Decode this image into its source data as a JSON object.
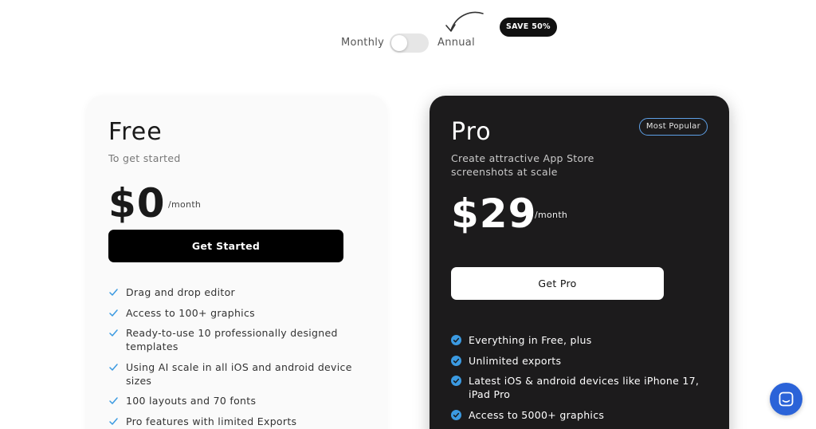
{
  "billing": {
    "monthly_label": "Monthly",
    "annual_label": "Annual",
    "toggle_on": false,
    "save_badge": "SAVE 50%"
  },
  "plans": [
    {
      "name": "Free",
      "description": "To get started",
      "price": "$0",
      "period": "/month",
      "cta": "Get Started",
      "features": [
        "Drag and drop editor",
        "Access to 100+ graphics",
        "Ready-to-use 10 professionally designed templates",
        "Using AI scale in all iOS and android device sizes",
        "100 layouts and 70 fonts",
        "Pro features with limited Exports"
      ]
    },
    {
      "name": "Pro",
      "badge": "Most Popular",
      "description": "Create attractive App Store screenshots at scale",
      "price": "$29",
      "period": "/month",
      "cta": "Get Pro",
      "features": [
        "Everything in Free, plus",
        "Unlimited exports",
        "Latest iOS & android devices like iPhone 17, iPad Pro",
        "Access to 5000+ graphics"
      ]
    }
  ],
  "icons": {
    "free_check": "check-icon",
    "pro_check": "check-circle-icon",
    "chat": "chat-icon",
    "arrow": "curved-arrow-icon"
  },
  "colors": {
    "accent_blue": "#2b63d8",
    "check_blue": "#3b9ae1",
    "pro_card_bg": "#1c1b1c",
    "badge_border": "#5ea0e6"
  }
}
